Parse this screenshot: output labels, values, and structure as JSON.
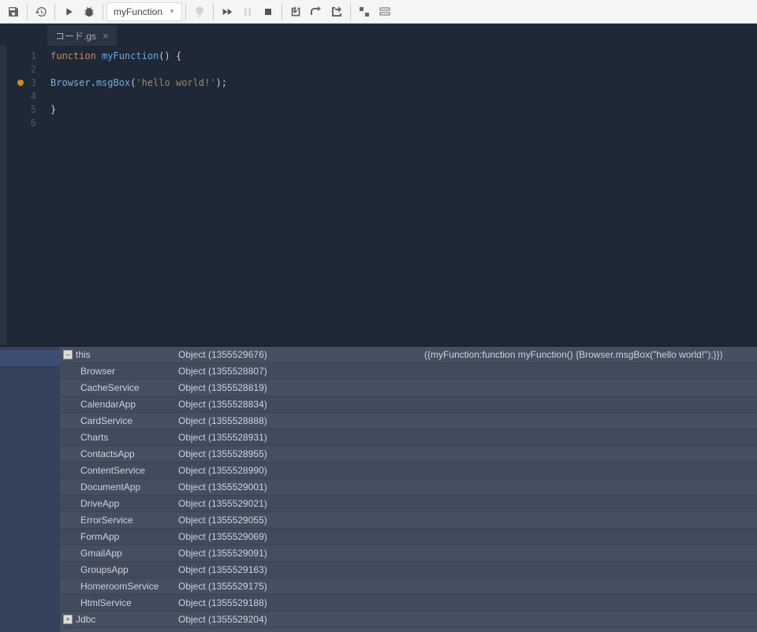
{
  "toolbar": {
    "functionName": "myFunction"
  },
  "tab": {
    "name": "コード.gs"
  },
  "code": {
    "lines": [
      "1",
      "2",
      "3",
      "4",
      "5",
      "6"
    ],
    "l1_kw": "function",
    "l1_id": " myFunction",
    "l1_end": "() {",
    "l3_obj": "Browser",
    "l3_dot": ".",
    "l3_m": "msgBox",
    "l3_p1": "(",
    "l3_str": "'hello world!'",
    "l3_p2": ");",
    "l5": "}"
  },
  "scope": {
    "root": "this",
    "items": [
      {
        "name": "Browser",
        "val": "Object (1355528807)"
      },
      {
        "name": "CacheService",
        "val": "Object (1355528819)"
      },
      {
        "name": "CalendarApp",
        "val": "Object (1355528834)"
      },
      {
        "name": "CardService",
        "val": "Object (1355528888)"
      },
      {
        "name": "Charts",
        "val": "Object (1355528931)"
      },
      {
        "name": "ContactsApp",
        "val": "Object (1355528955)"
      },
      {
        "name": "ContentService",
        "val": "Object (1355528990)"
      },
      {
        "name": "DocumentApp",
        "val": "Object (1355529001)"
      },
      {
        "name": "DriveApp",
        "val": "Object (1355529021)"
      },
      {
        "name": "ErrorService",
        "val": "Object (1355529055)"
      },
      {
        "name": "FormApp",
        "val": "Object (1355529069)"
      },
      {
        "name": "GmailApp",
        "val": "Object (1355529091)"
      },
      {
        "name": "GroupsApp",
        "val": "Object (1355529163)"
      },
      {
        "name": "HomeroomService",
        "val": "Object (1355529175)"
      },
      {
        "name": "HtmlService",
        "val": "Object (1355529188)"
      },
      {
        "name": "Jdbc",
        "val": "Object (1355529204)"
      }
    ],
    "rootVal": "Object (1355529676)",
    "expr": "({myFunction:function myFunction() {Browser.msgBox(\"hello world!\");}})"
  }
}
